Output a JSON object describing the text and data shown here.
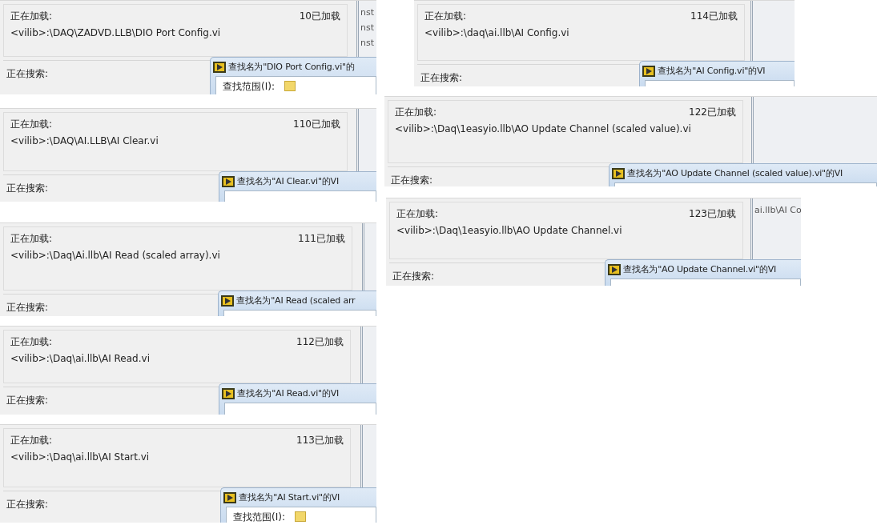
{
  "snippets": [
    {
      "loading_label": "正在加载:",
      "count": "10已加载",
      "path": "<vilib>:\\DAQ\\ZADVD.LLB\\DIO Port Config.vi",
      "search_label": "正在搜索:",
      "dialog_title": "查找名为\"DIO Port Config.vi\"的",
      "scope_label": "查找范围(I):",
      "side_texts": [
        "nst",
        "nst",
        "nst"
      ]
    },
    {
      "loading_label": "正在加载:",
      "count": "110已加载",
      "path": "<vilib>:\\DAQ\\AI.LLB\\AI Clear.vi",
      "search_label": "正在搜索:",
      "dialog_title": "查找名为\"AI Clear.vi\"的VI"
    },
    {
      "loading_label": "正在加载:",
      "count": "111已加载",
      "path": "<vilib>:\\Daq\\Ai.llb\\AI Read (scaled array).vi",
      "search_label": "正在搜索:",
      "dialog_title": "查找名为\"AI Read (scaled arr"
    },
    {
      "loading_label": "正在加载:",
      "count": "112已加载",
      "path": "<vilib>:\\Daq\\ai.llb\\AI Read.vi",
      "search_label": "正在搜索:",
      "dialog_title": "查找名为\"AI Read.vi\"的VI"
    },
    {
      "loading_label": "正在加载:",
      "count": "113已加载",
      "path": "<vilib>:\\Daq\\ai.llb\\AI Start.vi",
      "search_label": "正在搜索:",
      "dialog_title": "查找名为\"AI Start.vi\"的VI",
      "scope_label": "查找范围(I):"
    },
    {
      "loading_label": "正在加载:",
      "count": "114已加载",
      "path": "<vilib>:\\daq\\ai.llb\\AI Config.vi",
      "search_label": "正在搜索:",
      "dialog_title": "查找名为\"AI Config.vi\"的VI"
    },
    {
      "loading_label": "正在加载:",
      "count": "122已加载",
      "path": "<vilib>:\\Daq\\1easyio.llb\\AO Update Channel (scaled value).vi",
      "search_label": "正在搜索:",
      "dialog_title": "查找名为\"AO Update Channel (scaled value).vi\"的VI"
    },
    {
      "loading_label": "正在加载:",
      "count": "123已加载",
      "path": "<vilib>:\\Daq\\1easyio.llb\\AO Update Channel.vi",
      "search_label": "正在搜索:",
      "dialog_title": "查找名为\"AO Update Channel.vi\"的VI",
      "side_texts": [
        "ai.llb\\AI Co"
      ]
    }
  ]
}
